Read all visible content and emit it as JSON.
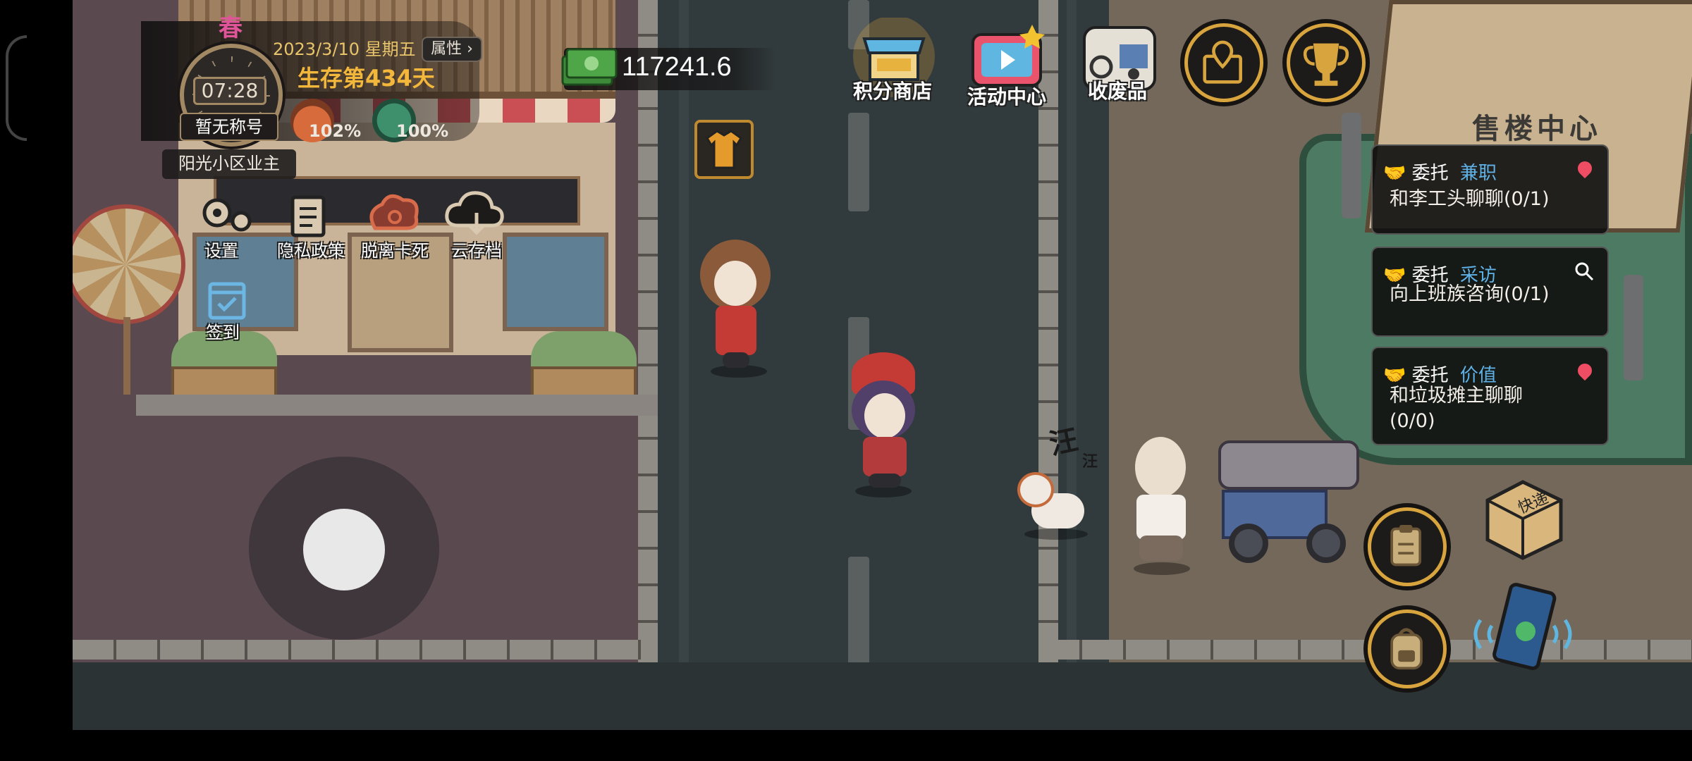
{
  "hud": {
    "season": "春",
    "date": "2023/3/10 星期五",
    "time": "07:28",
    "survival": "生存第434天",
    "attributes_button": "属性",
    "title_badge": "暂无称号",
    "owner_badge": "阳光小区业主",
    "hunger": "102%",
    "health": "100%",
    "money": "117241.6"
  },
  "top_bar": {
    "points_shop": "积分商店",
    "activity_center": "活动中心",
    "recycle": "收废品",
    "map_icon": "map-pin-icon",
    "trophy_icon": "trophy-icon"
  },
  "menu": {
    "settings": "设置",
    "privacy": "隐私政策",
    "unstuck": "脱离卡死",
    "cloud_save": "云存档",
    "checkin": "签到"
  },
  "quests": [
    {
      "kind": "委托",
      "type": "兼职",
      "text": "和李工头聊聊(0/1)",
      "icon": "location-pin-icon"
    },
    {
      "kind": "委托",
      "type": "采访",
      "text": "向上班族咨询(0/1)",
      "icon": "search-icon"
    },
    {
      "kind": "委托",
      "type": "价值",
      "text": "和垃圾摊主聊聊",
      "text2": "(0/0)",
      "icon": "location-pin-icon"
    }
  ],
  "scene": {
    "sales_center_sign": "售楼中心",
    "bark_big": "汪",
    "bark_small": "汪",
    "express_box_label": "快递"
  },
  "colors": {
    "accent_gold": "#d8a43d",
    "quest_type_blue": "#5fb2e8",
    "survival_orange": "#f3b73c",
    "pin_red": "#ee4d63"
  }
}
